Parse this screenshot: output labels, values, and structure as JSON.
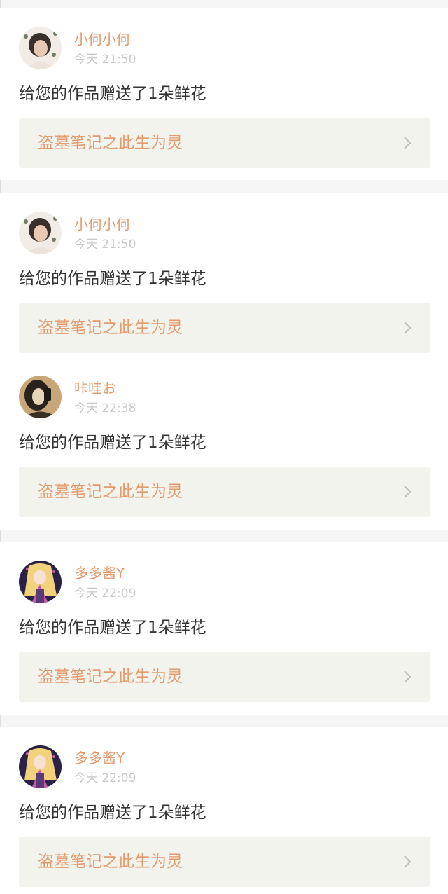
{
  "notifications": [
    {
      "username": "小何小何",
      "time": "今天 21:50",
      "message": "给您的作品赠送了1朵鲜花",
      "work_title": "盗墓笔记之此生为灵",
      "avatar_icon": "avatar-girl-portrait",
      "avatar_colors": [
        "#f2ece6",
        "#3a2f2b",
        "#e8c9b4"
      ]
    },
    {
      "username": "小何小何",
      "time": "今天 21:50",
      "message": "给您的作品赠送了1朵鲜花",
      "work_title": "盗墓笔记之此生为灵",
      "avatar_icon": "avatar-girl-portrait",
      "avatar_colors": [
        "#f2ece6",
        "#3a2f2b",
        "#e8c9b4"
      ]
    },
    {
      "username": "咔哇お",
      "time": "今天 22:38",
      "message": "给您的作品赠送了1朵鲜花",
      "work_title": "盗墓笔记之此生为灵",
      "avatar_icon": "avatar-girl-selfie",
      "avatar_colors": [
        "#c7a77a",
        "#2a221c",
        "#e7d5b8"
      ]
    },
    {
      "username": "多多酱Y",
      "time": "今天 22:09",
      "message": "给您的作品赠送了1朵鲜花",
      "work_title": "盗墓笔记之此生为灵",
      "avatar_icon": "avatar-anime-girl",
      "avatar_colors": [
        "#2b2147",
        "#f2d27a",
        "#c45aa8"
      ]
    },
    {
      "username": "多多酱Y",
      "time": "今天 22:09",
      "message": "给您的作品赠送了1朵鲜花",
      "work_title": "盗墓笔记之此生为灵",
      "avatar_icon": "avatar-anime-girl",
      "avatar_colors": [
        "#2b2147",
        "#f2d27a",
        "#c45aa8"
      ]
    }
  ],
  "theme": {
    "accent": "#e39a6c",
    "text": "#333333",
    "muted": "#c8c8c8",
    "card_link_bg": "#f3f3ee",
    "page_bg": "#f5f5f5"
  }
}
